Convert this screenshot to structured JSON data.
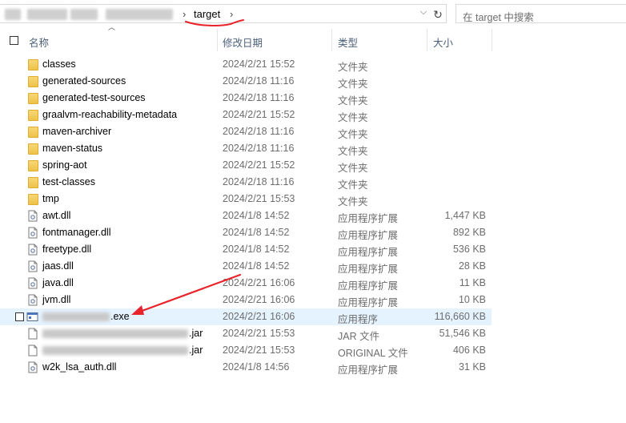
{
  "address": {
    "current_folder": "target",
    "separator": "›",
    "dropdown_icon": "chevron-down-icon",
    "refresh_icon": "refresh-icon"
  },
  "search": {
    "placeholder": "在 target 中搜索"
  },
  "columns": {
    "name": "名称",
    "date": "修改日期",
    "type": "类型",
    "size": "大小"
  },
  "files": [
    {
      "name": "classes",
      "date": "2024/2/21 15:52",
      "type": "文件夹",
      "size": "",
      "kind": "folder"
    },
    {
      "name": "generated-sources",
      "date": "2024/2/18 11:16",
      "type": "文件夹",
      "size": "",
      "kind": "folder"
    },
    {
      "name": "generated-test-sources",
      "date": "2024/2/18 11:16",
      "type": "文件夹",
      "size": "",
      "kind": "folder"
    },
    {
      "name": "graalvm-reachability-metadata",
      "date": "2024/2/21 15:52",
      "type": "文件夹",
      "size": "",
      "kind": "folder"
    },
    {
      "name": "maven-archiver",
      "date": "2024/2/18 11:16",
      "type": "文件夹",
      "size": "",
      "kind": "folder"
    },
    {
      "name": "maven-status",
      "date": "2024/2/18 11:16",
      "type": "文件夹",
      "size": "",
      "kind": "folder"
    },
    {
      "name": "spring-aot",
      "date": "2024/2/21 15:52",
      "type": "文件夹",
      "size": "",
      "kind": "folder"
    },
    {
      "name": "test-classes",
      "date": "2024/2/18 11:16",
      "type": "文件夹",
      "size": "",
      "kind": "folder"
    },
    {
      "name": "tmp",
      "date": "2024/2/21 15:53",
      "type": "文件夹",
      "size": "",
      "kind": "folder"
    },
    {
      "name": "awt.dll",
      "date": "2024/1/8 14:52",
      "type": "应用程序扩展",
      "size": "1,447 KB",
      "kind": "dll"
    },
    {
      "name": "fontmanager.dll",
      "date": "2024/1/8 14:52",
      "type": "应用程序扩展",
      "size": "892 KB",
      "kind": "dll"
    },
    {
      "name": "freetype.dll",
      "date": "2024/1/8 14:52",
      "type": "应用程序扩展",
      "size": "536 KB",
      "kind": "dll"
    },
    {
      "name": "jaas.dll",
      "date": "2024/1/8 14:52",
      "type": "应用程序扩展",
      "size": "28 KB",
      "kind": "dll"
    },
    {
      "name": "java.dll",
      "date": "2024/2/21 16:06",
      "type": "应用程序扩展",
      "size": "11 KB",
      "kind": "dll"
    },
    {
      "name": "jvm.dll",
      "date": "2024/2/21 16:06",
      "type": "应用程序扩展",
      "size": "10 KB",
      "kind": "dll"
    },
    {
      "name": ".exe",
      "date": "2024/2/21 16:06",
      "type": "应用程序",
      "size": "116,660 KB",
      "kind": "exe",
      "selected": true,
      "blurred": true
    },
    {
      "name": ".jar",
      "date": "2024/2/21 15:53",
      "type": "JAR 文件",
      "size": "51,546 KB",
      "kind": "file",
      "blurred": true
    },
    {
      "name": ".jar",
      "date": "2024/2/21 15:53",
      "type": "ORIGINAL 文件",
      "size": "406 KB",
      "kind": "file",
      "blurred": true
    },
    {
      "name": "w2k_lsa_auth.dll",
      "date": "2024/1/8 14:56",
      "type": "应用程序扩展",
      "size": "31 KB",
      "kind": "dll"
    }
  ],
  "colors": {
    "folder": "#f0c54e",
    "selected_row": "#e5f3ff",
    "annotation": "#e8232a",
    "header_text": "#4c607a"
  }
}
